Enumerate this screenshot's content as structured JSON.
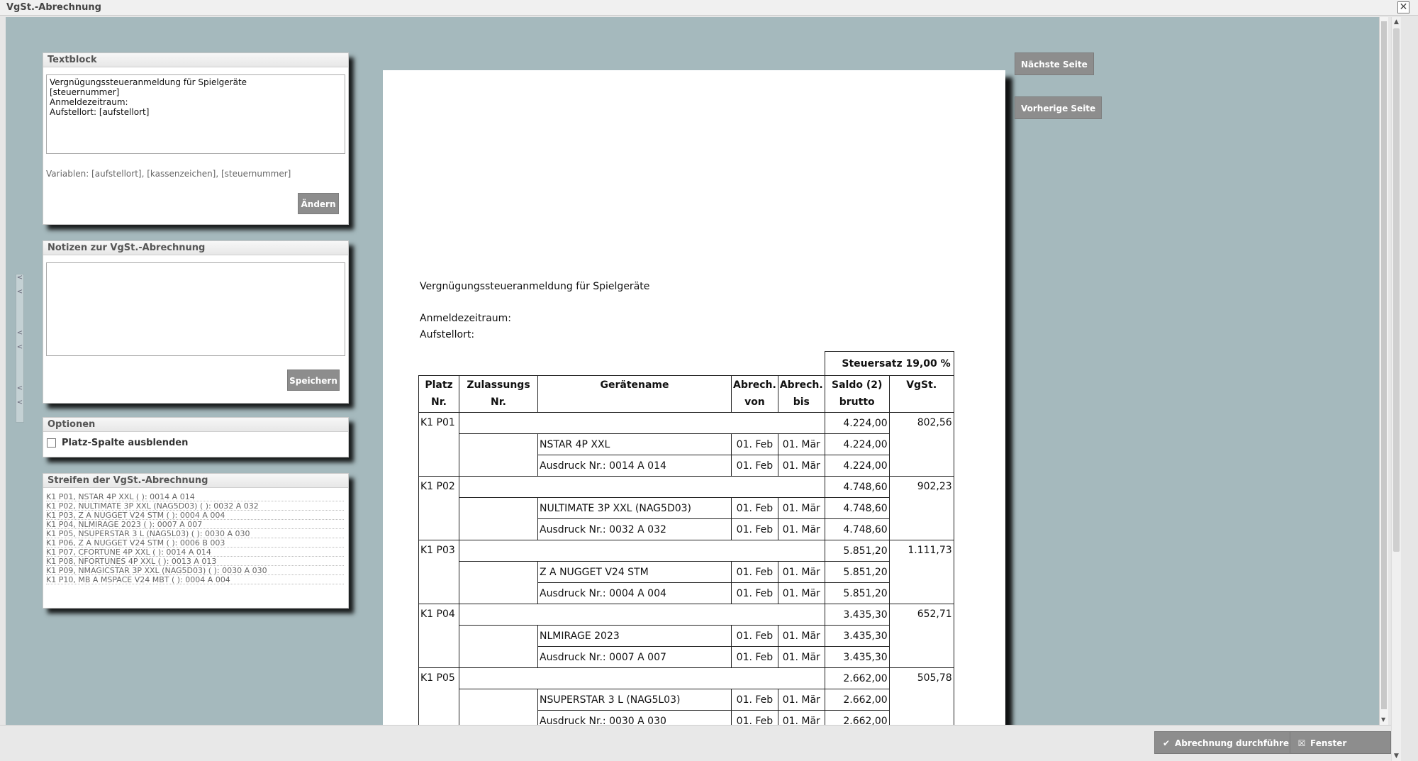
{
  "window": {
    "title": "VgSt.-Abrechnung",
    "close_glyph": "✕"
  },
  "textblock": {
    "heading": "Textblock",
    "text": "Vergnügungssteueranmeldung für Spielgeräte\n[steuernummer]\nAnmeldezeitraum:\nAufstellort: [aufstellort]",
    "variables": "Variablen: [aufstellort], [kassenzeichen], [steuernummer]",
    "button": "Ändern"
  },
  "notes": {
    "heading": "Notizen zur VgSt.-Abrechnung",
    "text": "",
    "button": "Speichern"
  },
  "options": {
    "heading": "Optionen",
    "checkbox_label": "Platz-Spalte ausblenden"
  },
  "strips": {
    "heading": "Streifen der VgSt.-Abrechnung",
    "items": [
      "K1 P01, NSTAR 4P XXL (                ): 0014 A 014",
      "K1 P02, NULTIMATE 3P XXL (NAG5D03) (                ): 0032 A 032",
      "K1 P03, Z A NUGGET V24 STM (                ): 0004 A 004",
      "K1 P04, NLMIRAGE 2023 (                ): 0007 A 007",
      "K1 P05, NSUPERSTAR 3 L (NAG5L03) (                ): 0030 A 030",
      "K1 P06, Z A NUGGET V24 STM (                ): 0006 B 003",
      "K1 P07, CFORTUNE 4P XXL (                ): 0014 A 014",
      "K1 P08, NFORTUNES 4P XXL (                ): 0013 A 013",
      "K1 P09, NMAGICSTAR 3P XXL (NAG5D03) (                ): 0030 A 030",
      "K1 P10, MB A MSPACE V24 MBT (                ): 0004 A 004"
    ]
  },
  "document": {
    "title_line": "Vergnügungssteueranmeldung für Spielgeräte",
    "period_line": "Anmeldezeitraum:",
    "location_line": "Aufstellort:",
    "tax_rate": "Steuersatz 19,00 %",
    "headers": {
      "platz": "Platz Nr.",
      "zulassung": "Zulassungs Nr.",
      "geraet": "Gerätename",
      "von": "Abrech. von",
      "bis": "Abrech. bis",
      "saldo": "Saldo (2) brutto",
      "vgst": "VgSt."
    },
    "groups": [
      {
        "platz": "K1 P01",
        "saldo": "4.224,00",
        "vgst": "802,56",
        "rows": [
          {
            "name": "NSTAR 4P XXL",
            "von": "01. Feb",
            "bis": "01. Mär",
            "saldo": "4.224,00"
          },
          {
            "name": "Ausdruck Nr.: 0014 A 014",
            "von": "01. Feb",
            "bis": "01. Mär",
            "saldo": "4.224,00"
          }
        ]
      },
      {
        "platz": "K1 P02",
        "saldo": "4.748,60",
        "vgst": "902,23",
        "rows": [
          {
            "name": "NULTIMATE 3P XXL (NAG5D03)",
            "von": "01. Feb",
            "bis": "01. Mär",
            "saldo": "4.748,60"
          },
          {
            "name": "Ausdruck Nr.: 0032 A 032",
            "von": "01. Feb",
            "bis": "01. Mär",
            "saldo": "4.748,60"
          }
        ]
      },
      {
        "platz": "K1 P03",
        "saldo": "5.851,20",
        "vgst": "1.111,73",
        "rows": [
          {
            "name": "Z A NUGGET V24 STM",
            "von": "01. Feb",
            "bis": "01. Mär",
            "saldo": "5.851,20"
          },
          {
            "name": "Ausdruck Nr.: 0004 A 004",
            "von": "01. Feb",
            "bis": "01. Mär",
            "saldo": "5.851,20"
          }
        ]
      },
      {
        "platz": "K1 P04",
        "saldo": "3.435,30",
        "vgst": "652,71",
        "rows": [
          {
            "name": "NLMIRAGE 2023",
            "von": "01. Feb",
            "bis": "01. Mär",
            "saldo": "3.435,30"
          },
          {
            "name": "Ausdruck Nr.: 0007 A 007",
            "von": "01. Feb",
            "bis": "01. Mär",
            "saldo": "3.435,30"
          }
        ]
      },
      {
        "platz": "K1 P05",
        "saldo": "2.662,00",
        "vgst": "505,78",
        "rows": [
          {
            "name": "NSUPERSTAR 3 L (NAG5L03)",
            "von": "01. Feb",
            "bis": "01. Mär",
            "saldo": "2.662,00"
          },
          {
            "name": "Ausdruck Nr.: 0030 A 030",
            "von": "01. Feb",
            "bis": "01. Mär",
            "saldo": "2.662,00"
          }
        ]
      }
    ]
  },
  "pager": {
    "next": "Nächste Seite",
    "prev": "Vorherige Seite"
  },
  "footer": {
    "run_label": "Abrechnung durchführen",
    "close_label": "Fenster schließen",
    "run_icon": "check-icon",
    "close_icon": "close-box-icon"
  }
}
